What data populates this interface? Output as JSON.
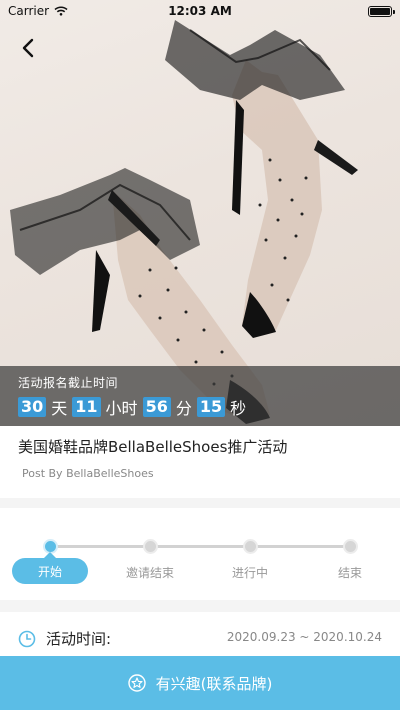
{
  "status_bar": {
    "carrier": "Carrier",
    "time": "12:03 AM"
  },
  "countdown": {
    "label": "活动报名截止时间",
    "days": "30",
    "days_unit": "天",
    "hours": "11",
    "hours_unit": "小时",
    "minutes": "56",
    "minutes_unit": "分",
    "seconds": "15",
    "seconds_unit": "秒"
  },
  "event": {
    "title": "美国婚鞋品牌BellaBelleShoes推广活动",
    "subtitle": "Post By BellaBelleShoes"
  },
  "progress": {
    "steps": [
      "开始",
      "邀请结束",
      "进行中",
      "结束"
    ],
    "active_index": 0
  },
  "event_time": {
    "label": "活动时间:",
    "value": "2020.09.23 ~ 2020.10.24"
  },
  "cta": {
    "label": "有兴趣(联系品牌)"
  },
  "colors": {
    "accent": "#5bbde6",
    "countdown_num": "#3b9ad6"
  }
}
